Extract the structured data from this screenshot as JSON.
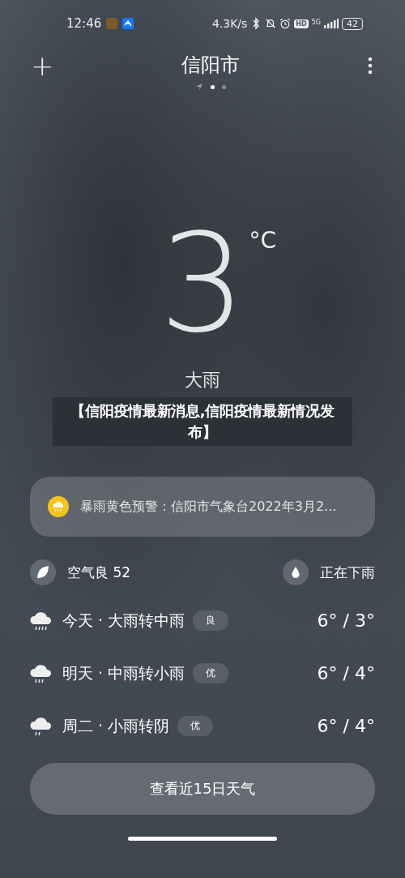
{
  "status_bar": {
    "time": "12:46",
    "net_speed": "4.3K/s",
    "hd": "HD",
    "network": "5G",
    "battery": "42"
  },
  "header": {
    "add": "+",
    "city": "信阳市",
    "pages": [
      {
        "kind": "location",
        "selected": false
      },
      {
        "kind": "dot",
        "selected": true
      },
      {
        "kind": "dot",
        "selected": false
      }
    ]
  },
  "current": {
    "temperature": "3",
    "unit": "°C",
    "condition": "大雨"
  },
  "banner": "【信阳疫情最新消息,信阳疫情最新情况发布】",
  "alert": {
    "text": "暴雨黄色预警：信阳市气象台2022年3月2...",
    "color": "#f5c518"
  },
  "info": [
    {
      "kind": "leaf",
      "text": "空气良 52"
    },
    {
      "kind": "drop",
      "text": "正在下雨"
    }
  ],
  "forecast": [
    {
      "day": "今天 · 大雨转中雨",
      "aqi": "良",
      "temps": "6° / 3°",
      "kind": "heavy"
    },
    {
      "day": "明天 · 中雨转小雨",
      "aqi": "优",
      "temps": "6° / 4°",
      "kind": "moderate"
    },
    {
      "day": "周二 · 小雨转阴",
      "aqi": "优",
      "temps": "6° / 4°",
      "kind": "light"
    }
  ],
  "button": "查看近15日天气"
}
